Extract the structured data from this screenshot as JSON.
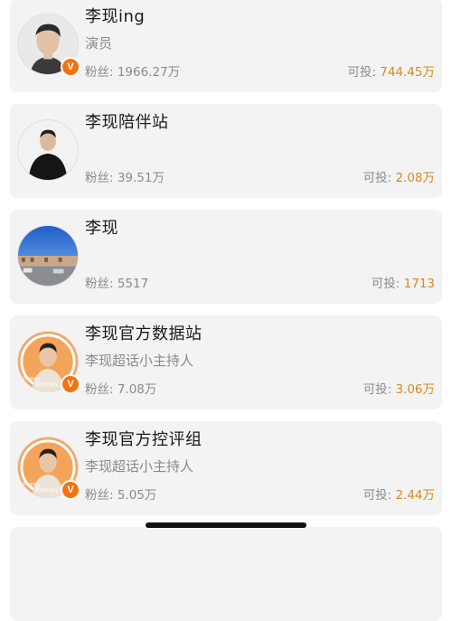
{
  "accounts": [
    {
      "name": "李现ing",
      "description": "演员",
      "fans_label": "粉丝: 1966.27万",
      "invest_prefix": "可投: ",
      "invest_value": "744.45万",
      "verified": true,
      "avatar": "portrait-man-icon"
    },
    {
      "name": "李现陪伴站",
      "description": "",
      "fans_label": "粉丝: 39.51万",
      "invest_prefix": "可投: ",
      "invest_value": "2.08万",
      "verified": false,
      "avatar": "portrait-man-black-shirt-icon"
    },
    {
      "name": "李现",
      "description": "",
      "fans_label": "粉丝: 5517",
      "invest_prefix": "可投: ",
      "invest_value": "1713",
      "verified": false,
      "avatar": "blue-sky-street-icon"
    },
    {
      "name": "李现官方数据站",
      "description": "李现超话小主持人",
      "fans_label": "粉丝: 7.08万",
      "invest_prefix": "可投: ",
      "invest_value": "3.06万",
      "verified": true,
      "avatar": "happy-birthday-portrait-icon",
      "avatar_text": [
        "Happy",
        "Birthday"
      ]
    },
    {
      "name": "李现官方控评组",
      "description": "李现超话小主持人",
      "fans_label": "粉丝: 5.05万",
      "invest_prefix": "可投: ",
      "invest_value": "2.44万",
      "verified": true,
      "avatar": "happy-birthday-portrait-icon",
      "avatar_text": [
        "Happy",
        "Birthday"
      ]
    }
  ],
  "verified_badge": "V",
  "colors": {
    "card_bg": "#f3f3f3",
    "accent_orange": "#d68a1e",
    "badge": "#f5730f",
    "muted_text": "#8a8a8a"
  }
}
